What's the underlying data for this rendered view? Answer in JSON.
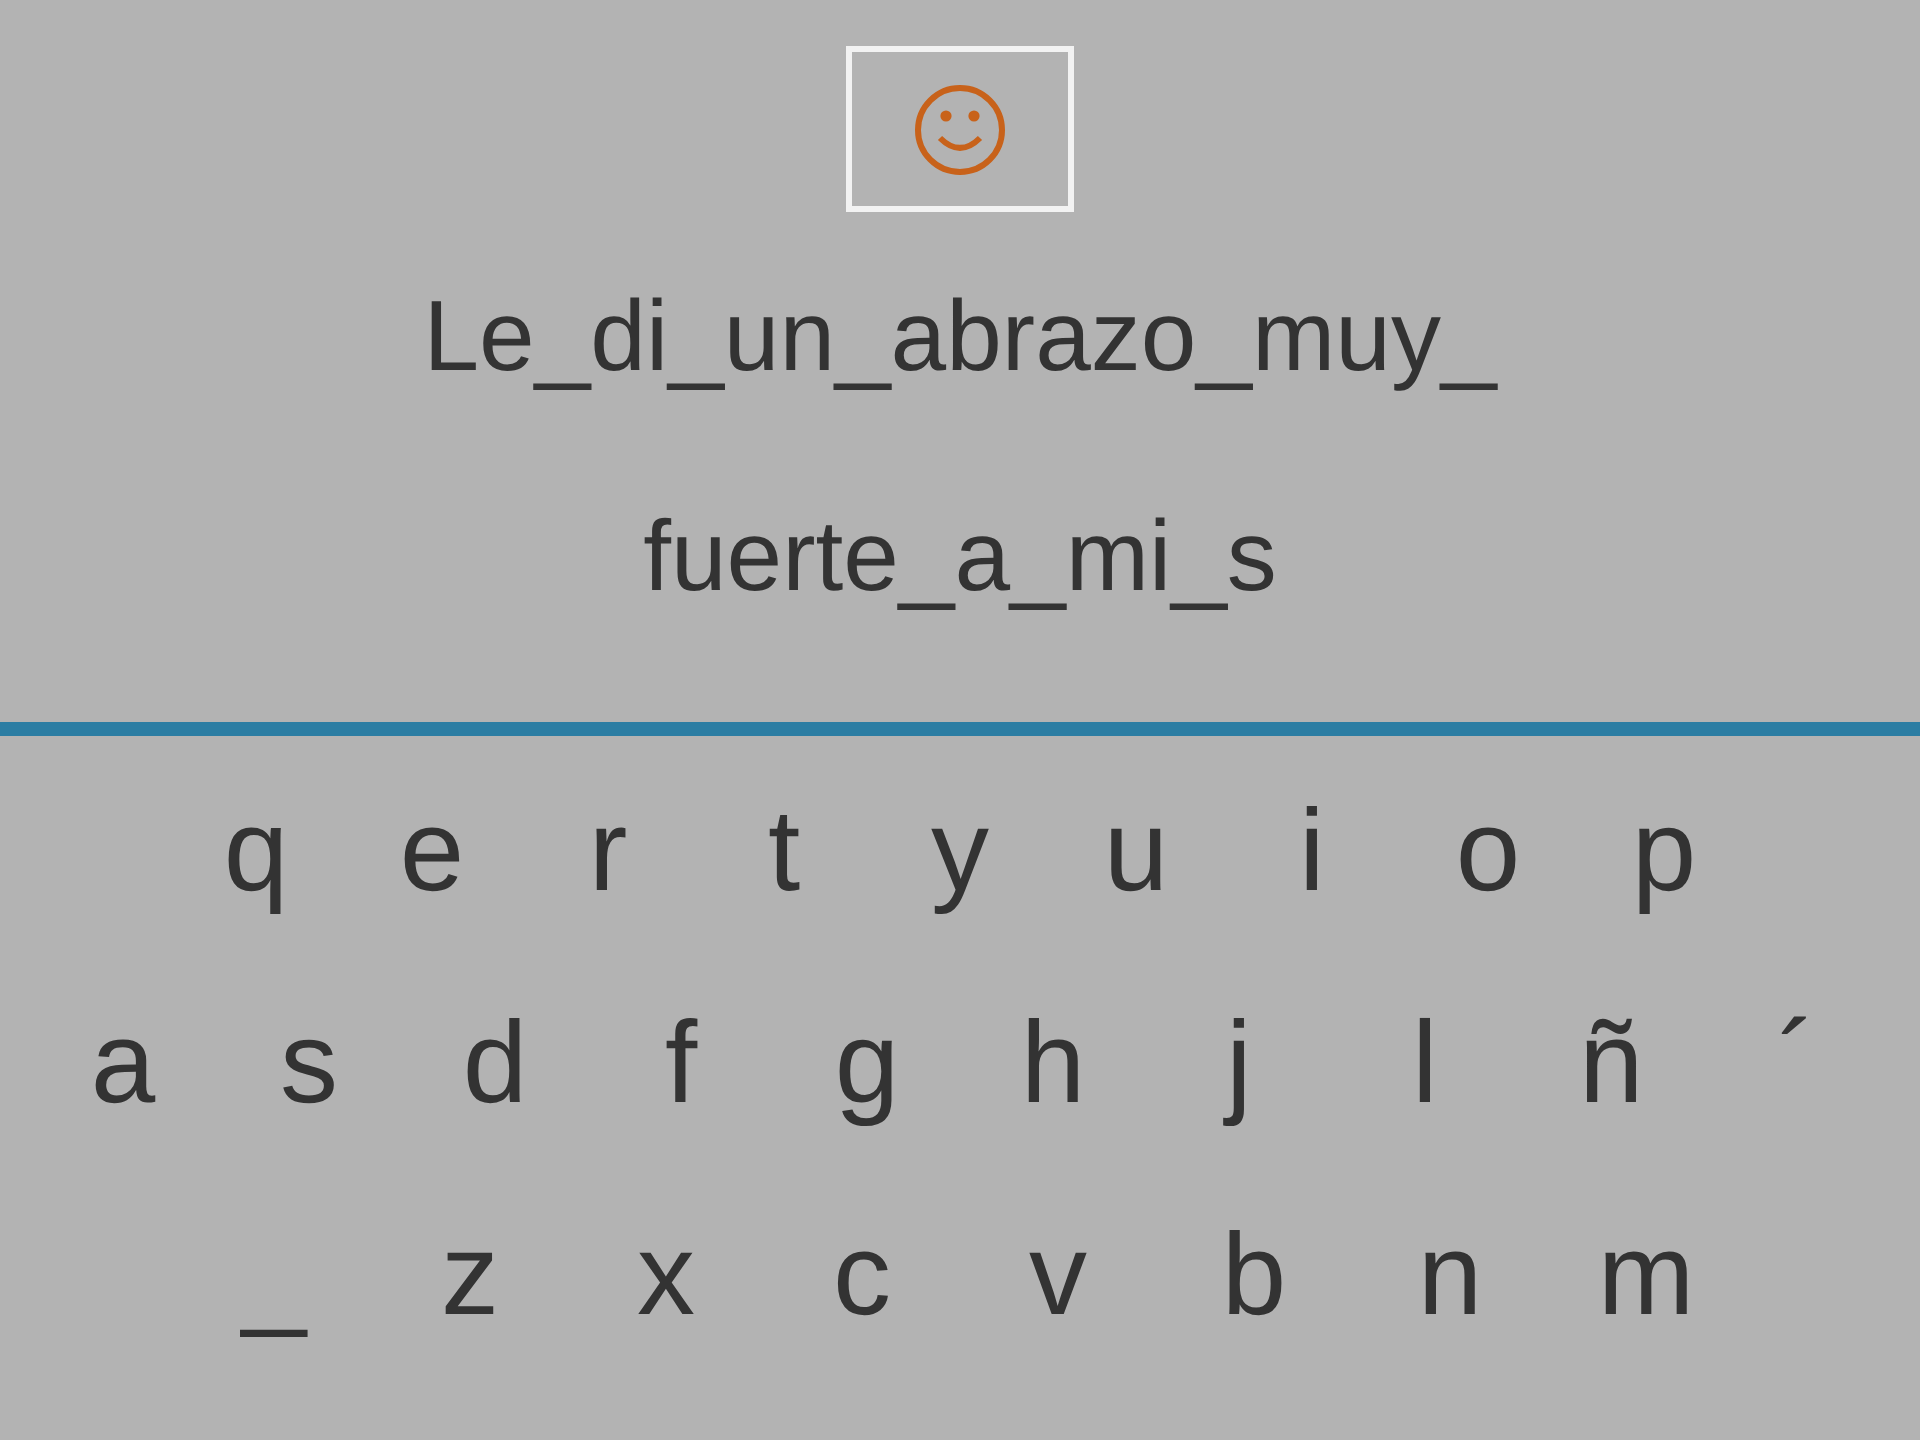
{
  "sentence_lines": [
    "Le_di_un_abrazo_muy_",
    "fuerte_a_mi_s"
  ],
  "keyboard_rows": [
    [
      "q",
      "e",
      "r",
      "t",
      "y",
      "u",
      "i",
      "o",
      "p"
    ],
    [
      "a",
      "s",
      "d",
      "f",
      "g",
      "h",
      "j",
      "l",
      "ñ",
      "´"
    ],
    [
      "_",
      "z",
      "x",
      "c",
      "v",
      "b",
      "n",
      "m"
    ]
  ]
}
